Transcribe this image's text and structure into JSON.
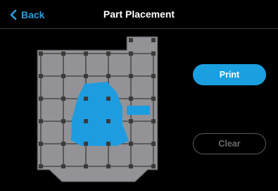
{
  "header": {
    "back_label": "Back",
    "title": "Part Placement",
    "accent": "#2a9ee0"
  },
  "actions": {
    "print_label": "Print",
    "clear_label": "Clear"
  },
  "colors": {
    "plate": "#939397",
    "grid": "#3b3b3b",
    "part": "#1e9ce0",
    "background": "#000000"
  },
  "icons": {
    "back": "chevron-left-icon"
  }
}
